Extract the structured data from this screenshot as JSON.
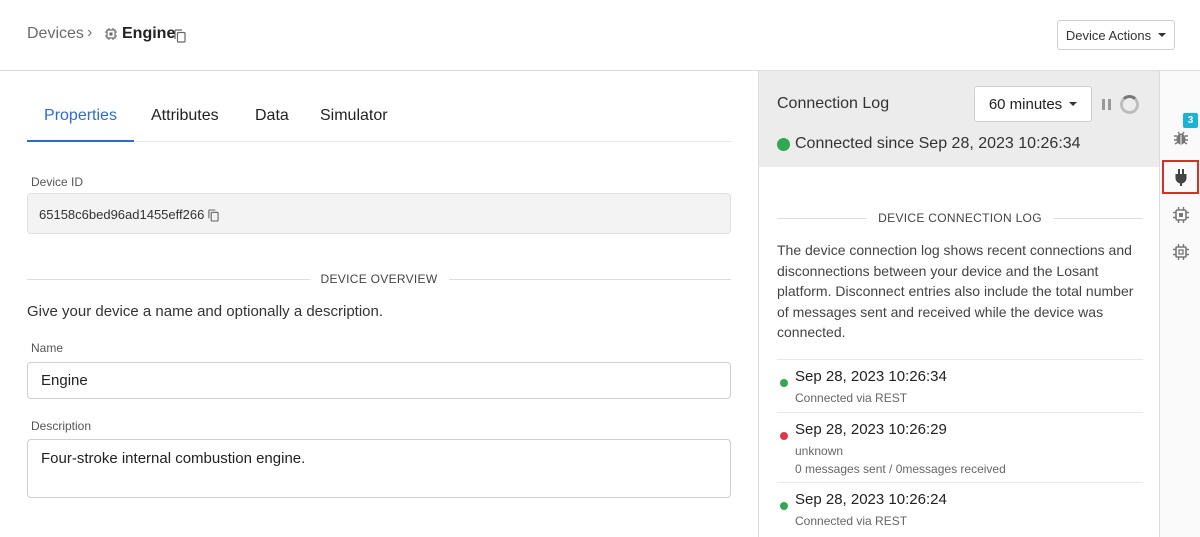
{
  "header": {
    "breadcrumb_root": "Devices",
    "breadcrumb_separator": "›",
    "device_name": "Engine",
    "device_actions_label": "Device Actions"
  },
  "tabs": [
    {
      "label": "Properties",
      "active": true
    },
    {
      "label": "Attributes",
      "active": false
    },
    {
      "label": "Data",
      "active": false
    },
    {
      "label": "Simulator",
      "active": false
    }
  ],
  "properties": {
    "device_id_label": "Device ID",
    "device_id_value": "65158c6bed96ad1455eff266",
    "overview_heading": "DEVICE OVERVIEW",
    "overview_help": "Give your device a name and optionally a description.",
    "name_label": "Name",
    "name_value": "Engine",
    "description_label": "Description",
    "description_value": "Four-stroke internal combustion engine."
  },
  "connection_log": {
    "title": "Connection Log",
    "range_label": "60 minutes",
    "status_text": "Connected since Sep 28, 2023 10:26:34",
    "section_heading": "DEVICE CONNECTION LOG",
    "description": "The device connection log shows recent connections and disconnections between your device and the Losant platform. Disconnect entries also include the total number of messages sent and received while the device was connected.",
    "entries": [
      {
        "timestamp": "Sep 28, 2023 10:26:34",
        "line1": "Connected via REST",
        "line2": "",
        "status": "connected"
      },
      {
        "timestamp": "Sep 28, 2023 10:26:29",
        "line1": "unknown",
        "line2": "0 messages sent / 0messages received",
        "status": "disconnected"
      },
      {
        "timestamp": "Sep 28, 2023 10:26:24",
        "line1": "Connected via REST",
        "line2": "",
        "status": "connected"
      }
    ]
  },
  "rail": {
    "debug_badge": "3",
    "items": [
      "debug-icon",
      "plug-icon",
      "device-settings-icon",
      "device-icon"
    ]
  },
  "colors": {
    "accent": "#2a6bd6",
    "connected": "#2fa84f",
    "disconnected": "#e0384b",
    "badge": "#19b3d6",
    "highlight": "#d93025"
  }
}
